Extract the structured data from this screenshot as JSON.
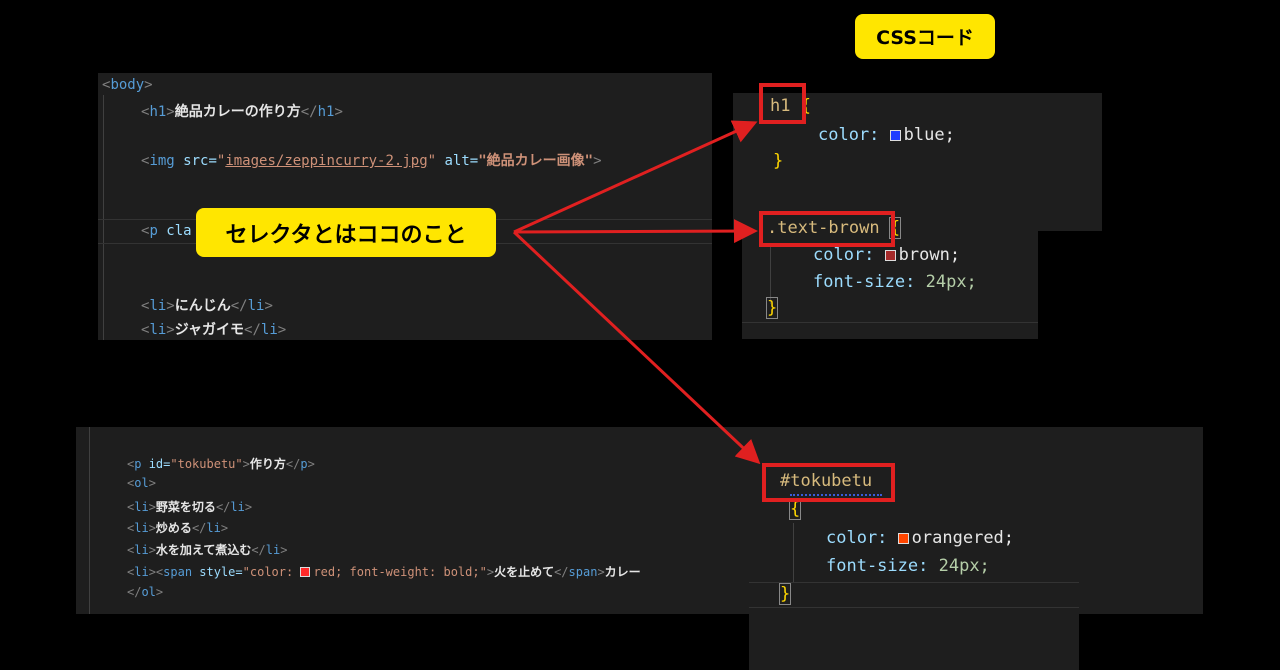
{
  "css_label": "CSSコード",
  "callout_label": "セレクタとはココのこと",
  "html_top": {
    "lines": {
      "body_open": {
        "lt": "<",
        "tag": "body",
        "gt": ">"
      },
      "h1": {
        "lt": "<",
        "tag": "h1",
        "gt": ">",
        "text": "絶品カレーの作り方",
        "close_lt": "</",
        "close_tag": "h1",
        "close_gt": ">"
      },
      "img": {
        "lt": "<",
        "tag": "img",
        "src_attr": "src=",
        "src_q": "\"",
        "src_val": "images/zeppincurry-2.jpg",
        "src_q2": "\"",
        "alt_attr": " alt=",
        "alt_val": "\"絶品カレー画像\"",
        "gt": ">"
      },
      "p_cla": {
        "lt": "<",
        "tag": "p",
        "attr": " cla"
      },
      "li1": {
        "lt": "<",
        "tag": "li",
        "gt": ">",
        "text": "にんじん",
        "close_lt": "</",
        "close_tag": "li",
        "close_gt": ">"
      },
      "li2": {
        "lt": "<",
        "tag": "li",
        "gt": ">",
        "text": "ジャガイモ",
        "close_lt": "</",
        "close_tag": "li",
        "close_gt": ">"
      }
    }
  },
  "css_top": {
    "h1_sel": "h1",
    "brace_open": "{",
    "brace_close": "}",
    "h1_prop": "color:",
    "h1_val": "blue;",
    "h1_color": "#1f3cff",
    "tb_sel": ".text-brown",
    "tb_prop1": "color:",
    "tb_val1": "brown;",
    "tb_color": "#a52a2a",
    "tb_prop2": "font-size:",
    "tb_val2": "24px;"
  },
  "html_bottom": {
    "p": {
      "lt": "<",
      "tag": "p",
      "attr": " id=",
      "val": "\"tokubetu\"",
      "gt": ">",
      "text": "作り方",
      "close": "</",
      "close_tag": "p",
      "close_gt": ">"
    },
    "ol_open": {
      "lt": "<",
      "tag": "ol",
      "gt": ">"
    },
    "li1": {
      "text": "野菜を切る"
    },
    "li2": {
      "text": "炒める"
    },
    "li3": {
      "text": "水を加えて煮込む"
    },
    "li4": {
      "span_attr": " style=",
      "q1": "\"color: ",
      "swatch_color": "#ff2a2a",
      "val": "red; font-weight: bold;\"",
      "text": "火を止めて",
      "after": "カレー"
    },
    "ol_close": {
      "lt": "</",
      "tag": "ol",
      "gt": ">"
    },
    "li_tag": "li",
    "span_tag": "span",
    "lt": "<",
    "gt": ">",
    "close_lt": "</"
  },
  "css_bottom": {
    "sel": "#tokubetu",
    "brace_open": "{",
    "brace_close": "}",
    "prop1": "color:",
    "val1": "orangered;",
    "color1": "#ff4500",
    "prop2": "font-size:",
    "val2": "24px;"
  }
}
